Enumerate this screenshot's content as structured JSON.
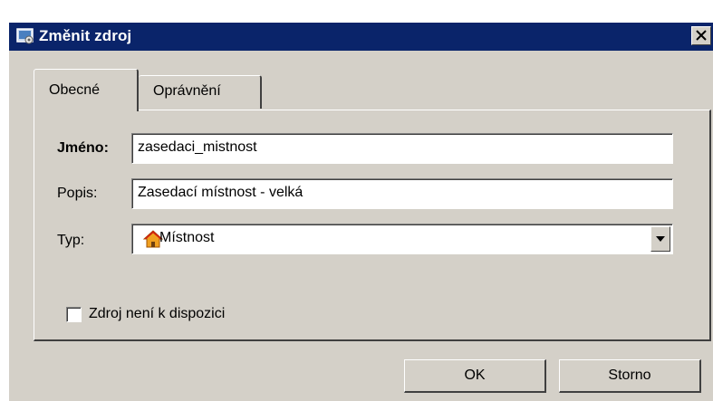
{
  "window": {
    "title": "Změnit zdroj",
    "title_icon": "resource-icon",
    "close_icon": "close-icon"
  },
  "tabs": [
    {
      "label": "Obecné",
      "active": true
    },
    {
      "label": "Oprávnění",
      "active": false
    }
  ],
  "form": {
    "name_label": "Jméno:",
    "name_value": "zasedaci_mistnost",
    "description_label": "Popis:",
    "description_value": "Zasedací místnost - velká",
    "type_label": "Typ:",
    "type_value": "Místnost",
    "type_icon": "house-icon",
    "unavailable_label": "Zdroj není k dispozici",
    "unavailable_checked": false
  },
  "buttons": {
    "ok_label": "OK",
    "cancel_label": "Storno"
  },
  "colors": {
    "titlebar": "#0a246a",
    "window_face": "#d4d0c8"
  }
}
